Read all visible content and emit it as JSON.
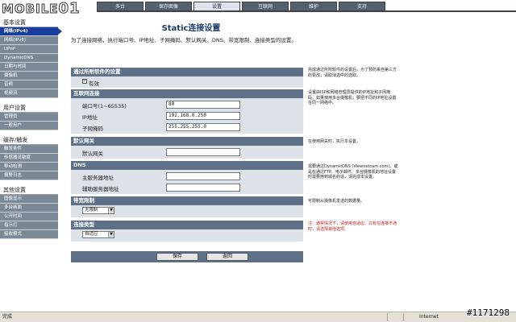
{
  "logo": {
    "text": "MOBILE",
    "suffix": "01"
  },
  "tabs": [
    "多台",
    "保存图像",
    "设置",
    "互联网",
    "维护",
    "支持"
  ],
  "active_tab": 2,
  "sidebar": {
    "sections": [
      {
        "title": "基本设置",
        "items": [
          "网络(IPv4)",
          "网络(IPv6)",
          "UPnP",
          "DynamicDNS",
          "日期与时间",
          "摄像机",
          "音频",
          "视频流"
        ]
      },
      {
        "title": "用户设置",
        "items": [
          "管理员",
          "一般用户"
        ]
      },
      {
        "title": "缓存/触发",
        "items": [
          "触发条件",
          "传感器灵敏度",
          "移动检测",
          "报警日志"
        ]
      },
      {
        "title": "其他设置",
        "items": [
          "图像显示",
          "多台画面",
          "公开时间",
          "指示灯",
          "接收模式"
        ]
      }
    ],
    "active_item": "网络(IPv4)"
  },
  "page": {
    "title": "Static连接设置",
    "intro": "为了连接网络，执行端口号、IP地址、子网掩码、默认网关、DNS、带宽限制、连接类型的设置。"
  },
  "sections": {
    "auto": {
      "title": "通过所附软件的设置",
      "checkbox_label": "有效",
      "checked": true
    },
    "inet": {
      "title": "互联网连接",
      "fields": [
        {
          "label": "端口号(1~65535)",
          "value": "80"
        },
        {
          "label": "IP地址",
          "value": "192.168.0.250"
        },
        {
          "label": "子网掩码",
          "value": "255.255.255.0"
        }
      ]
    },
    "gateway": {
      "title": "默认网关",
      "field_label": "默认网关",
      "value": ""
    },
    "dns": {
      "title": "DNS",
      "fields": [
        {
          "label": "主服务器地址",
          "value": ""
        },
        {
          "label": "辅助服务器地址",
          "value": ""
        }
      ]
    },
    "bandwidth": {
      "title": "带宽限制",
      "selected": "无限制"
    },
    "conn": {
      "title": "连接类型",
      "selected": "自适应"
    }
  },
  "help": {
    "auto": "完成通过所附软件的设置后，为了预防来自第三方的更改，请取消选中的选取。",
    "inet": "设置由ISP和网络管理员提供的IP地址和子网掩码。如果使用多台摄像机，要把不同的IP地址设置在同一网络中。",
    "gateway": "在使用网关时，执行本设置。",
    "dns": "需要通过DynamicDNS (Viewnetcam.com)、或是在通过FTP、电子邮件、多台摄像机的地址设置时需要用到域名的话，请完成本设置。",
    "bandwidth": "可限制从摄像机发送的数据量。",
    "conn": "注：通常情况下，请使用自适应。只有在连接不通时，请选择其他选项。"
  },
  "buttons": {
    "save": "保存",
    "back": "返回"
  },
  "status": {
    "left": "完成",
    "zone": "Internet",
    "watermark": "#1171298"
  }
}
